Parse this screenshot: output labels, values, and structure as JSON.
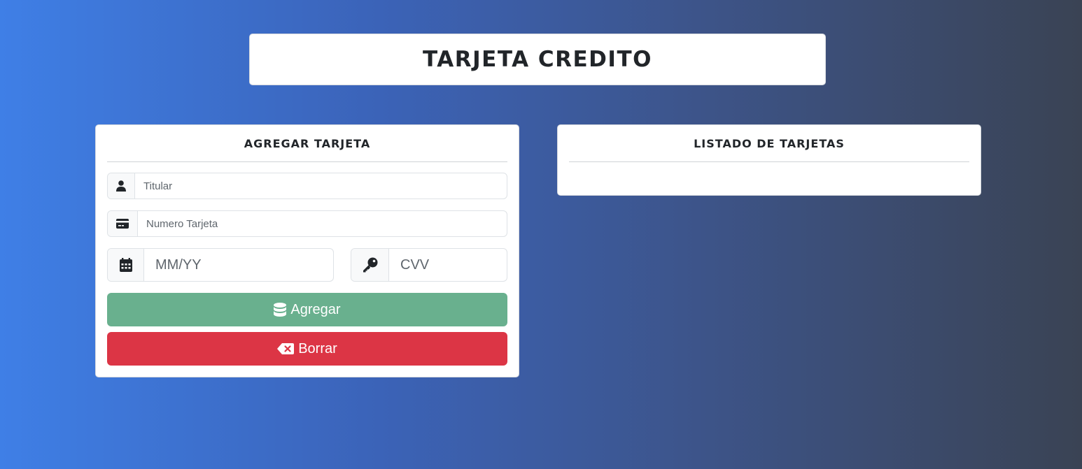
{
  "title": "TARJETA CREDITO",
  "form": {
    "header": "AGREGAR TARJETA",
    "holder_placeholder": "Titular",
    "number_placeholder": "Numero Tarjeta",
    "expiry_placeholder": "MM/YY",
    "cvv_placeholder": "CVV",
    "add_label": "Agregar",
    "delete_label": "Borrar",
    "icons": {
      "holder": "user-icon",
      "number": "credit-card-icon",
      "expiry": "calendar-icon",
      "cvv": "key-icon",
      "add": "database-icon",
      "delete": "backspace-icon"
    }
  },
  "list": {
    "header": "LISTADO DE TARJETAS"
  },
  "colors": {
    "add_button": "#69b08e",
    "delete_button": "#dc3545",
    "gradient_start": "#3f7fe6",
    "gradient_end": "#3a4354"
  }
}
